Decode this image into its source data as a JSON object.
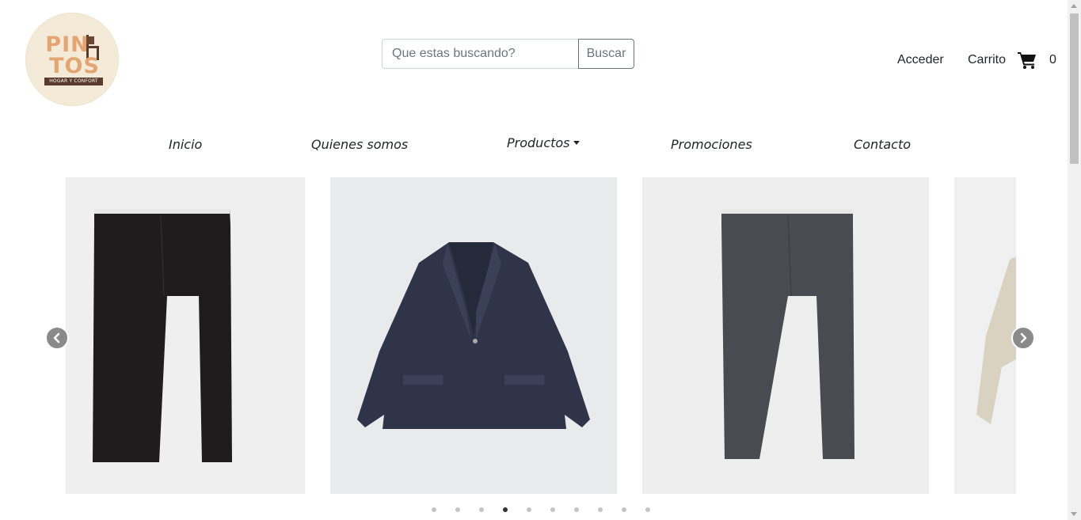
{
  "logo": {
    "line1": "PIN",
    "line2": "TOS",
    "tagline": "HOGAR Y CONFORT"
  },
  "search": {
    "placeholder": "Que estas buscando?",
    "button_label": "Buscar"
  },
  "user": {
    "login_label": "Acceder",
    "cart_label": "Carrito",
    "cart_count": "0"
  },
  "nav": {
    "items": [
      {
        "label": "Inicio"
      },
      {
        "label": "Quienes somos"
      },
      {
        "label": "Productos"
      },
      {
        "label": "Promociones"
      },
      {
        "label": "Contacto"
      }
    ]
  },
  "carousel": {
    "slides": [
      {
        "item": "black-trousers",
        "color": "#1e1c1d"
      },
      {
        "item": "navy-blazer",
        "color": "#2f3448"
      },
      {
        "item": "grey-trousers",
        "color": "#4a4b52"
      },
      {
        "item": "beige-jacket",
        "color": "#d9d2c0"
      }
    ],
    "indicator_count": 10,
    "active_indicator": 4
  },
  "colors": {
    "logo_bg": "#f3ead8",
    "logo_text": "#e3a571",
    "button_border": "#6c757d",
    "text": "#212529"
  }
}
